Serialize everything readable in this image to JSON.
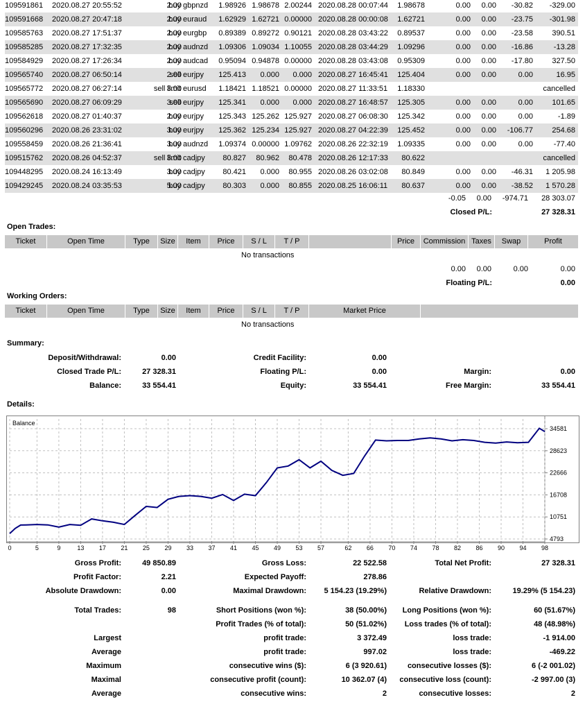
{
  "closed_trades": {
    "rows": [
      [
        "109591861",
        "2020.08.27 20:55:52",
        "buy",
        "2.00",
        "gbpnzd",
        "1.98926",
        "1.98678",
        "2.00244",
        "2020.08.28 00:07:44",
        "1.98678",
        "0.00",
        "0.00",
        "-30.82",
        "-329.00"
      ],
      [
        "109591668",
        "2020.08.27 20:47:18",
        "buy",
        "2.00",
        "euraud",
        "1.62929",
        "1.62721",
        "0.00000",
        "2020.08.28 00:00:08",
        "1.62721",
        "0.00",
        "0.00",
        "-23.75",
        "-301.98"
      ],
      [
        "109585763",
        "2020.08.27 17:51:37",
        "buy",
        "2.00",
        "eurgbp",
        "0.89389",
        "0.89272",
        "0.90121",
        "2020.08.28 03:43:22",
        "0.89537",
        "0.00",
        "0.00",
        "-23.58",
        "390.51"
      ],
      [
        "109585285",
        "2020.08.27 17:32:35",
        "buy",
        "2.00",
        "audnzd",
        "1.09306",
        "1.09034",
        "1.10055",
        "2020.08.28 03:44:29",
        "1.09296",
        "0.00",
        "0.00",
        "-16.86",
        "-13.28"
      ],
      [
        "109584929",
        "2020.08.27 17:26:34",
        "buy",
        "2.00",
        "audcad",
        "0.95094",
        "0.94878",
        "0.00000",
        "2020.08.28 03:43:08",
        "0.95309",
        "0.00",
        "0.00",
        "-17.80",
        "327.50"
      ],
      [
        "109565740",
        "2020.08.27 06:50:14",
        "sell",
        "2.00",
        "eurjpy",
        "125.413",
        "0.000",
        "0.000",
        "2020.08.27 16:45:41",
        "125.404",
        "0.00",
        "0.00",
        "0.00",
        "16.95"
      ],
      [
        "109565772",
        "2020.08.27 06:27:14",
        "sell limit",
        "3.00",
        "eurusd",
        "1.18421",
        "1.18521",
        "0.00000",
        "2020.08.27 11:33:51",
        "1.18330",
        "",
        "",
        "",
        "cancelled"
      ],
      [
        "109565690",
        "2020.08.27 06:09:29",
        "sell",
        "3.00",
        "eurjpy",
        "125.341",
        "0.000",
        "0.000",
        "2020.08.27 16:48:57",
        "125.305",
        "0.00",
        "0.00",
        "0.00",
        "101.65"
      ],
      [
        "109562618",
        "2020.08.27 01:40:37",
        "buy",
        "2.00",
        "eurjpy",
        "125.343",
        "125.262",
        "125.927",
        "2020.08.27 06:08:30",
        "125.342",
        "0.00",
        "0.00",
        "0.00",
        "-1.89"
      ],
      [
        "109560296",
        "2020.08.26 23:31:02",
        "buy",
        "3.00",
        "eurjpy",
        "125.362",
        "125.234",
        "125.927",
        "2020.08.27 04:22:39",
        "125.452",
        "0.00",
        "0.00",
        "-106.77",
        "254.68"
      ],
      [
        "109558459",
        "2020.08.26 21:36:41",
        "buy",
        "3.00",
        "audnzd",
        "1.09374",
        "0.00000",
        "1.09762",
        "2020.08.26 22:32:19",
        "1.09335",
        "0.00",
        "0.00",
        "0.00",
        "-77.40"
      ],
      [
        "109515762",
        "2020.08.26 04:52:37",
        "sell limit",
        "3.00",
        "cadjpy",
        "80.827",
        "80.962",
        "80.478",
        "2020.08.26 12:17:33",
        "80.622",
        "",
        "",
        "",
        "cancelled"
      ],
      [
        "109448295",
        "2020.08.24 16:13:49",
        "buy",
        "3.00",
        "cadjpy",
        "80.421",
        "0.000",
        "80.955",
        "2020.08.26 03:02:08",
        "80.849",
        "0.00",
        "0.00",
        "-46.31",
        "1 205.98"
      ],
      [
        "109429245",
        "2020.08.24 03:35:53",
        "buy",
        "5.00",
        "cadjpy",
        "80.303",
        "0.000",
        "80.855",
        "2020.08.25 16:06:11",
        "80.637",
        "0.00",
        "0.00",
        "-38.52",
        "1 570.28"
      ]
    ],
    "totals": {
      "commission": "-0.05",
      "taxes": "0.00",
      "swap": "-974.71",
      "profit": "28 303.07"
    },
    "closed_pl_label": "Closed P/L:",
    "closed_pl_value": "27 328.31"
  },
  "open_trades": {
    "title": "Open Trades:",
    "headers": {
      "ticket": "Ticket",
      "open_time": "Open Time",
      "type": "Type",
      "size": "Size",
      "item": "Item",
      "price": "Price",
      "sl": "S / L",
      "tp": "T / P",
      "close_price": "Price",
      "commission": "Commission",
      "taxes": "Taxes",
      "swap": "Swap",
      "profit": "Profit"
    },
    "empty": "No transactions",
    "totals": {
      "commission": "0.00",
      "taxes": "0.00",
      "swap": "0.00",
      "profit": "0.00"
    },
    "floating_label": "Floating P/L:",
    "floating_value": "0.00"
  },
  "working_orders": {
    "title": "Working Orders:",
    "headers": {
      "ticket": "Ticket",
      "open_time": "Open Time",
      "type": "Type",
      "size": "Size",
      "item": "Item",
      "price": "Price",
      "sl": "S / L",
      "tp": "T / P",
      "market_price": "Market Price"
    },
    "empty": "No transactions"
  },
  "summary": {
    "title": "Summary:",
    "deposit_label": "Deposit/Withdrawal:",
    "deposit_value": "0.00",
    "credit_label": "Credit Facility:",
    "credit_value": "0.00",
    "closed_label": "Closed Trade P/L:",
    "closed_value": "27 328.31",
    "floating_label": "Floating P/L:",
    "floating_value": "0.00",
    "margin_label": "Margin:",
    "margin_value": "0.00",
    "balance_label": "Balance:",
    "balance_value": "33 554.41",
    "equity_label": "Equity:",
    "equity_value": "33 554.41",
    "free_margin_label": "Free Margin:",
    "free_margin_value": "33 554.41"
  },
  "details": {
    "title": "Details:",
    "stats": [
      [
        "Gross Profit:",
        "49 850.89",
        "Gross Loss:",
        "22 522.58",
        "Total Net Profit:",
        "27 328.31"
      ],
      [
        "Profit Factor:",
        "2.21",
        "Expected Payoff:",
        "278.86",
        "",
        ""
      ],
      [
        "Absolute Drawdown:",
        "0.00",
        "Maximal Drawdown:",
        "5 154.23 (19.29%)",
        "Relative Drawdown:",
        "19.29% (5 154.23)"
      ]
    ],
    "trades": [
      [
        "Total Trades:",
        "98",
        "Short Positions (won %):",
        "38 (50.00%)",
        "Long Positions (won %):",
        "60 (51.67%)"
      ],
      [
        "",
        "",
        "Profit Trades (% of total):",
        "50 (51.02%)",
        "Loss trades (% of total):",
        "48 (48.98%)"
      ],
      [
        "Largest",
        "",
        "profit trade:",
        "3 372.49",
        "loss trade:",
        "-1 914.00"
      ],
      [
        "Average",
        "",
        "profit trade:",
        "997.02",
        "loss trade:",
        "-469.22"
      ],
      [
        "Maximum",
        "",
        "consecutive wins ($):",
        "6 (3 920.61)",
        "consecutive losses ($):",
        "6 (-2 001.02)"
      ],
      [
        "Maximal",
        "",
        "consecutive profit (count):",
        "10 362.07 (4)",
        "consecutive loss (count):",
        "-2 997.00 (3)"
      ],
      [
        "Average",
        "",
        "consecutive wins:",
        "2",
        "consecutive losses:",
        "2"
      ]
    ]
  },
  "chart_data": {
    "type": "line",
    "legend": "Balance",
    "y_ticks": [
      "34581",
      "28623",
      "22666",
      "16708",
      "10751",
      "4793"
    ],
    "ylim": [
      4793,
      34581
    ],
    "x_ticks": [
      "0",
      "5",
      "9",
      "13",
      "17",
      "21",
      "25",
      "29",
      "33",
      "37",
      "41",
      "45",
      "49",
      "53",
      "57",
      "62",
      "66",
      "70",
      "74",
      "78",
      "82",
      "86",
      "90",
      "94",
      "98"
    ],
    "xlim": [
      0,
      98
    ],
    "x": [
      0,
      1,
      2,
      3,
      5,
      7,
      9,
      11,
      13,
      15,
      17,
      19,
      21,
      23,
      25,
      27,
      29,
      31,
      33,
      35,
      37,
      39,
      41,
      43,
      45,
      47,
      49,
      51,
      53,
      55,
      57,
      59,
      61,
      63,
      65,
      67,
      69,
      71,
      73,
      75,
      77,
      79,
      81,
      83,
      85,
      87,
      89,
      91,
      93,
      95,
      97,
      98
    ],
    "values": [
      6250,
      7650,
      8550,
      8600,
      8700,
      8600,
      8000,
      8700,
      8500,
      10200,
      9700,
      9300,
      8700,
      11200,
      13600,
      13300,
      15500,
      16300,
      16500,
      16300,
      15800,
      16800,
      15200,
      16900,
      16500,
      20000,
      24000,
      24500,
      26200,
      24000,
      25800,
      23300,
      22000,
      22500,
      27200,
      31500,
      31300,
      31400,
      31400,
      31800,
      32100,
      31800,
      31300,
      31600,
      31400,
      30900,
      30700,
      31000,
      30800,
      30900,
      34700,
      33800
    ]
  },
  "colors": {
    "row_alt": "#e0e0e0",
    "header": "#c8c8c8",
    "line": "#000080",
    "grid": "#c0c0c0"
  }
}
